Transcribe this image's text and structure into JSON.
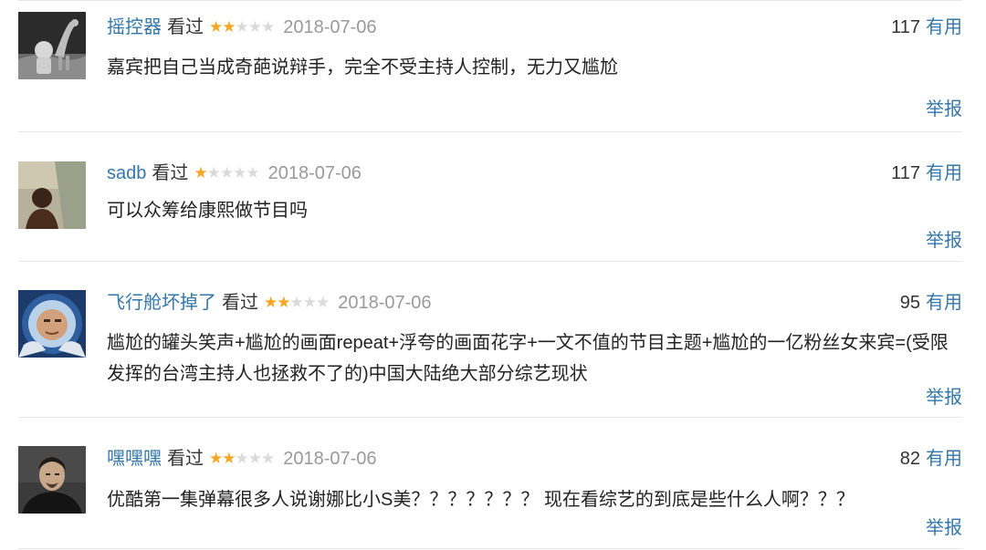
{
  "comments": [
    {
      "username": "摇控器",
      "status": "看过",
      "rating": 2,
      "date": "2018-07-06",
      "votes": "117",
      "useful_label": "有用",
      "content": "嘉宾把自己当成奇葩说辩手，完全不受主持人控制，无力又尴尬",
      "report_label": "举报",
      "avatar_icon": "astronaut-dinosaur-avatar"
    },
    {
      "username": "sadb",
      "status": "看过",
      "rating": 1,
      "date": "2018-07-06",
      "votes": "117",
      "useful_label": "有用",
      "content": "可以众筹给康熙做节目吗",
      "report_label": "举报",
      "avatar_icon": "person-silhouette-avatar"
    },
    {
      "username": "飞行舱坏掉了",
      "status": "看过",
      "rating": 2,
      "date": "2018-07-06",
      "votes": "95",
      "useful_label": "有用",
      "content": "尴尬的罐头笑声+尴尬的画面repeat+浮夸的画面花字+一文不值的节目主题+尴尬的一亿粉丝女来宾=(受限发挥的台湾主持人也拯救不了的)中国大陆绝大部分综艺现状",
      "report_label": "举报",
      "avatar_icon": "astronaut-helmet-avatar"
    },
    {
      "username": "嘿嘿嘿",
      "status": "看过",
      "rating": 2,
      "date": "2018-07-06",
      "votes": "82",
      "useful_label": "有用",
      "content": "优酷第一集弹幕很多人说谢娜比小S美？？？？？？？ 现在看综艺的到底是些什么人啊？？？",
      "report_label": "举报",
      "avatar_icon": "man-portrait-avatar"
    }
  ],
  "colors": {
    "link": "#3377aa",
    "star_on": "#f5a623",
    "star_off": "#dadada",
    "date": "#999999",
    "divider": "#e8e8e8"
  }
}
